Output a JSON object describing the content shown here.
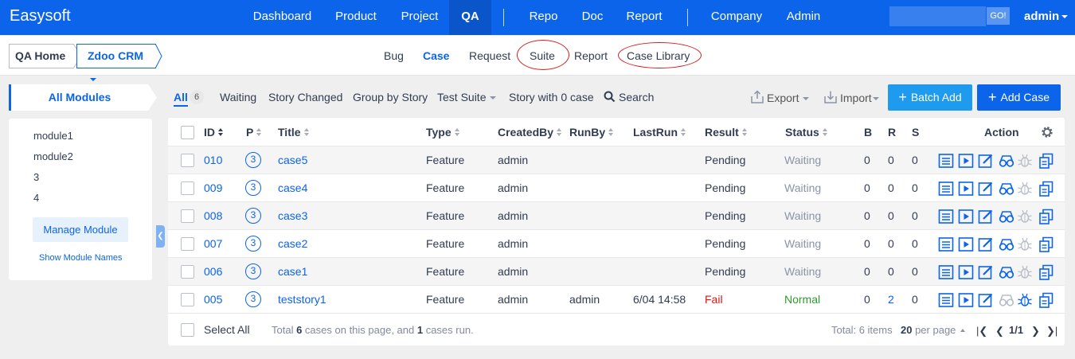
{
  "app": {
    "brand": "Easysoft"
  },
  "topnav": {
    "items": [
      "Dashboard",
      "Product",
      "Project",
      "QA",
      "Repo",
      "Doc",
      "Report",
      "Company",
      "Admin"
    ],
    "active": "QA"
  },
  "search": {
    "go_label": "GO!",
    "placeholder": ""
  },
  "user": {
    "name": "admin"
  },
  "breadcrumb": {
    "home": "QA Home",
    "product": "Zdoo CRM"
  },
  "subnav": {
    "items": [
      "Bug",
      "Case",
      "Request",
      "Suite",
      "Report",
      "Case Library"
    ],
    "active": "Case"
  },
  "sidebar": {
    "title": "All Modules",
    "modules": [
      "module1",
      "module2",
      "3",
      "4"
    ],
    "manage_label": "Manage Module",
    "show_names_label": "Show Module Names"
  },
  "filters": {
    "all_label": "All",
    "all_count": "6",
    "waiting": "Waiting",
    "story_changed": "Story Changed",
    "group_by_story": "Group by Story",
    "test_suite": "Test Suite",
    "story_with_0": "Story with 0 case",
    "search": "Search"
  },
  "toolbar": {
    "export": "Export",
    "import": "Import",
    "batch_add": "Batch Add",
    "add_case": "Add Case"
  },
  "table": {
    "headers": {
      "id": "ID",
      "p": "P",
      "title": "Title",
      "type": "Type",
      "created_by": "CreatedBy",
      "run_by": "RunBy",
      "last_run": "LastRun",
      "result": "Result",
      "status": "Status",
      "b": "B",
      "r": "R",
      "s": "S",
      "action": "Action"
    },
    "rows": [
      {
        "id": "010",
        "p": "3",
        "title": "case5",
        "type": "Feature",
        "created_by": "admin",
        "run_by": "",
        "last_run": "",
        "result": "Pending",
        "status": "Waiting",
        "b": "0",
        "r": "0",
        "s": "0"
      },
      {
        "id": "009",
        "p": "3",
        "title": "case4",
        "type": "Feature",
        "created_by": "admin",
        "run_by": "",
        "last_run": "",
        "result": "Pending",
        "status": "Waiting",
        "b": "0",
        "r": "0",
        "s": "0"
      },
      {
        "id": "008",
        "p": "3",
        "title": "case3",
        "type": "Feature",
        "created_by": "admin",
        "run_by": "",
        "last_run": "",
        "result": "Pending",
        "status": "Waiting",
        "b": "0",
        "r": "0",
        "s": "0"
      },
      {
        "id": "007",
        "p": "3",
        "title": "case2",
        "type": "Feature",
        "created_by": "admin",
        "run_by": "",
        "last_run": "",
        "result": "Pending",
        "status": "Waiting",
        "b": "0",
        "r": "0",
        "s": "0"
      },
      {
        "id": "006",
        "p": "3",
        "title": "case1",
        "type": "Feature",
        "created_by": "admin",
        "run_by": "",
        "last_run": "",
        "result": "Pending",
        "status": "Waiting",
        "b": "0",
        "r": "0",
        "s": "0"
      },
      {
        "id": "005",
        "p": "3",
        "title": "teststory1",
        "type": "Feature",
        "created_by": "admin",
        "run_by": "admin",
        "last_run": "6/04 14:58",
        "result": "Fail",
        "status": "Normal",
        "b": "0",
        "r": "2",
        "s": "0"
      }
    ]
  },
  "footer": {
    "select_all": "Select All",
    "summary_prefix": "Total ",
    "summary_cases": "6",
    "summary_mid": " cases on this page, and ",
    "summary_run": "1",
    "summary_suffix": " cases run.",
    "total_prefix": "Total: ",
    "total_items": "6",
    "total_suffix": " items",
    "per_page_num": "20",
    "per_page_label": " per page",
    "page": "1/1"
  },
  "colors": {
    "brand": "#0c64eb",
    "fail": "#e0140f",
    "normal": "#2e9b2e",
    "annotation": "#d81b1b"
  },
  "icons": [
    "caret-down-icon",
    "search-icon",
    "export-icon",
    "import-icon",
    "plus-icon",
    "settings-icon",
    "case-list-icon",
    "run-icon",
    "edit-icon",
    "review-icon",
    "bug-icon",
    "copy-icon"
  ]
}
